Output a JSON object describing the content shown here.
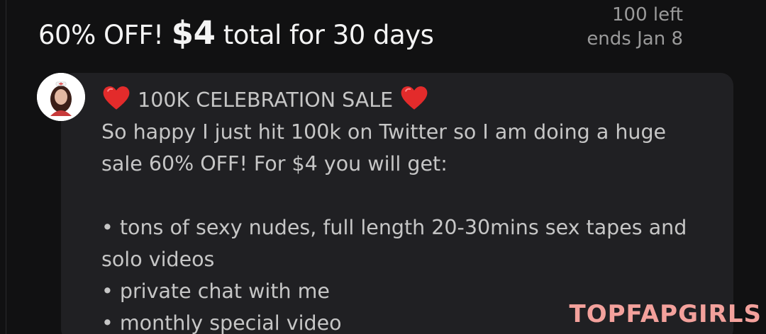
{
  "promo": {
    "title_prefix": "60% OFF!",
    "price": "$4",
    "title_suffix": "total for 30 days",
    "remaining": "100 left",
    "ends": "ends Jan 8"
  },
  "message": {
    "headline": "100K CELEBRATION SALE",
    "line1": "So happy I just hit 100k on Twitter so I am doing a huge",
    "line2": "sale 60% OFF! For $4 you will get:",
    "bullets": [
      "• tons of sexy nudes, full length 20-30mins sex tapes and",
      "solo videos",
      "• private chat with me",
      "• monthly special video"
    ]
  },
  "watermark": "TOPFAPGIRLS",
  "colors": {
    "background": "#111112",
    "card": "#202023",
    "heart": "#e32b2b",
    "watermark": "#f3a19c"
  }
}
